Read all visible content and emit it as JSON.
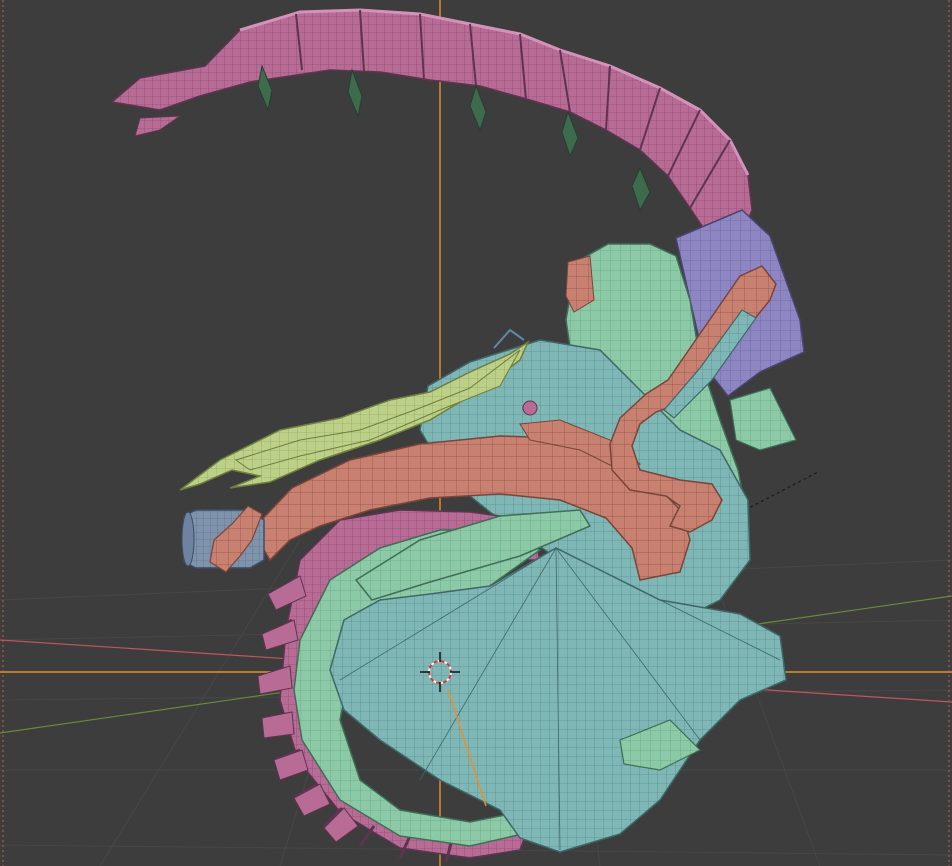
{
  "app": {
    "name": "3D viewport",
    "view_mode": "wireframe-overlay",
    "colors": {
      "background": "#3d3d3d",
      "grid_line": "#474747",
      "axis_x": "#c0555f",
      "axis_y": "#6a8a3a",
      "origin_line": "#e8902c",
      "teal": "#7fb7b6",
      "mint": "#8cc9a6",
      "pink": "#b76b95",
      "salmon": "#c88070",
      "lime": "#bdd088",
      "lavender": "#8e86c2",
      "steel": "#7f93ad"
    }
  },
  "scene": {
    "objects": [
      "tail-segment-mesh",
      "teal-body-mesh",
      "mint-shell-mesh",
      "salmon-strap-mesh",
      "lime-leaf-mesh",
      "lavender-panel-mesh",
      "pipe-mesh",
      "canister-mesh"
    ],
    "icons": [
      "3d-cursor-icon",
      "empty-object-marker"
    ]
  }
}
